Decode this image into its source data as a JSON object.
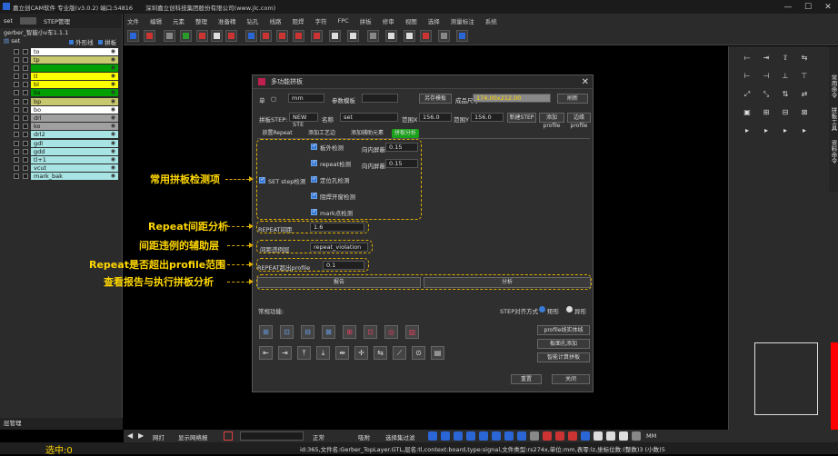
{
  "titlebar": {
    "app": "嘉立创CAM软件 专业版(v3.0.2) 端口:54816",
    "company": "深圳嘉立创科技集团股份有限公司(www.jlc.com)"
  },
  "left_panel": {
    "tab_set": "set",
    "tab_step": "STEP管理",
    "job_name": "gerber_智能小v车1.1.1",
    "header_name": "set",
    "outline_label": "外形线",
    "jigsaw_label": "拼板",
    "layers": [
      {
        "name": "to",
        "color": "#ffffff"
      },
      {
        "name": "tp",
        "color": "#c8c86e"
      },
      {
        "name": "",
        "color": "#00a000"
      },
      {
        "name": "tl",
        "color": "#ffff00"
      },
      {
        "name": "bl",
        "color": "#ffff00"
      },
      {
        "name": "bs",
        "color": "#00a000"
      },
      {
        "name": "bp",
        "color": "#c8c86e"
      },
      {
        "name": "bo",
        "color": "#ffffff"
      },
      {
        "name": "drl",
        "color": "#a0a0a0"
      },
      {
        "name": "ko",
        "color": "#a0a0a0"
      },
      {
        "name": "drl2",
        "color": "#a8e4e4"
      },
      {
        "name": "gdl",
        "color": "#a8e4e4"
      },
      {
        "name": "gdd",
        "color": "#a8e4e4"
      },
      {
        "name": "tl+1",
        "color": "#a8e4e4"
      },
      {
        "name": "vcut",
        "color": "#a8e4e4"
      },
      {
        "name": "mark_bak",
        "color": "#a8e4e4"
      }
    ],
    "bottom_label": "层管理",
    "selected": "选中:0"
  },
  "menu": [
    "文件",
    "编辑",
    "元素",
    "整理",
    "准备精",
    "钻孔",
    "线路",
    "阻焊",
    "字符",
    "FPC",
    "拼板",
    "修审",
    "视图",
    "选择",
    "测量标注",
    "系统"
  ],
  "dialog": {
    "title": "多功能拼板",
    "unit_label": "单",
    "unit": "mm",
    "param_template_label": "参数模板",
    "save_template": "另存模板",
    "board_size_label": "成品尺寸",
    "board_size": "174.00x212.00",
    "refresh": "刷新",
    "step_label": "拼板STEP:",
    "step_value": "NEW STE",
    "name_label": "名称",
    "name_value": "set",
    "range_x_label": "范围X",
    "range_x": "156.0",
    "range_y_label": "范围Y",
    "range_y": "156.0",
    "new_step": "新建STEP",
    "add_profile": "添加profile",
    "edit_profile": "边缘profile",
    "tabs": [
      "放置Repeat",
      "添加工艺边",
      "添加辅助元素",
      "拼板分析"
    ],
    "set_step_check": "SET step检测",
    "checks": [
      "板外检测",
      "repeat检测",
      "定位孔检测",
      "阻焊开窗检测",
      "mark点检测"
    ],
    "inner_dist_label": "向内屏蔽",
    "inner_dist_1": "0.15",
    "inner_dist_2": "0.15",
    "repeat_gap_label": "REPEAT间距",
    "repeat_gap": "1.6",
    "gap_layer_label": "间距违例层",
    "gap_layer": "repeat_violation",
    "repeat_profile_label": "REPEAT超出profile",
    "repeat_profile": "0.1",
    "report_btn": "报告",
    "analyze_btn": "分析",
    "bottom_label": "常规功能:",
    "align_label": "STEP对齐方式",
    "align_opt1": "矩形",
    "align_opt2": "异形",
    "profile_btn": "profile线实体线",
    "board_hole_btn": "板面孔添加",
    "smart_calc_btn": "智能计算拼板",
    "reset_btn": "重置",
    "close_btn": "关闭"
  },
  "annotations": {
    "a1": "常用拼板检测项",
    "a2": "Repeat间距分析",
    "a3": "间距违例的辅助层",
    "a4": "Repeat是否超出profile范围",
    "a5": "查看报告与执行拼板分析"
  },
  "bottom_toolbar": {
    "mode": "网打",
    "show_netlist": "显示网络报",
    "unit": "MM",
    "snap": "吸附",
    "filter": "选择集过滤",
    "mode2": "正常"
  },
  "status": "id:365,文件名:Gerber_TopLayer.GTL,层名:tl,context:board,type:signal,文件类型:rs274x,单位:mm,表零:lz,坐标位数:(整数)3 (小数)5",
  "right_panel": {
    "tab1": "常用命令",
    "tab2": "拼板工具",
    "tab3": "资料命令"
  },
  "colors": {
    "accent": "#e0b000",
    "dialog_bg": "#2f2f2f",
    "tab_active": "#1aa01a"
  }
}
